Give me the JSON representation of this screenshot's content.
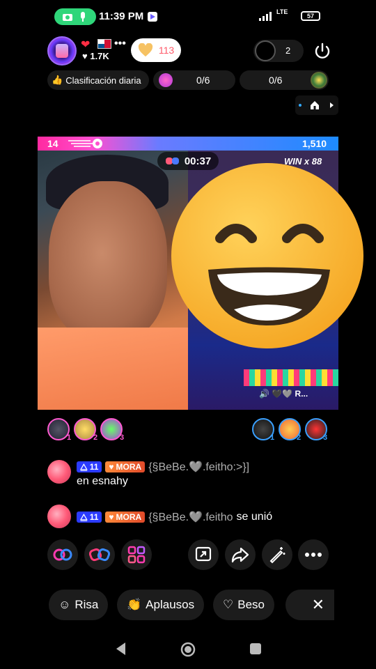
{
  "status_bar": {
    "time": "11:39 PM",
    "network": "LTE",
    "battery": "57"
  },
  "host": {
    "likes": "1.7K",
    "follow_count": "113",
    "viewer_count": "2"
  },
  "ranking": {
    "label": "Clasificación diaria",
    "goal_1": "0/6",
    "goal_2": "0/6"
  },
  "battle": {
    "left_score": "14",
    "right_score": "1,510",
    "timer": "00:37",
    "win_label": "WIN",
    "win_multiplier": "x 88",
    "opponent_name": "R..."
  },
  "supporters": {
    "left_ranks": [
      "1",
      "2",
      "3"
    ],
    "right_ranks": [
      "1",
      "2",
      "3"
    ]
  },
  "chat": [
    {
      "level": "11",
      "fan_club": "MORA",
      "username": "{§BeBe.🩶.feitho:>}]",
      "message": "en esnahy"
    },
    {
      "level": "11",
      "fan_club": "MORA",
      "username": "{§BeBe.🩶.feitho",
      "message": "se unió"
    }
  ],
  "quick_reactions": [
    "Risa",
    "Aplausos",
    "Beso"
  ],
  "colors": {
    "battle_pink": "#ff2aa0",
    "battle_blue": "#1d8bff",
    "status_green": "#2fd67a",
    "level_blue": "#2b3bff",
    "fan_orange": "#e04a2a"
  },
  "icons": {
    "toolbar_left": [
      "link-icon",
      "battle-gloves-icon",
      "apps-icon"
    ],
    "toolbar_right": [
      "share-screen-icon",
      "share-icon",
      "magic-wand-icon",
      "more-icon"
    ],
    "nav": [
      "back-icon",
      "home-icon",
      "recents-icon"
    ]
  }
}
